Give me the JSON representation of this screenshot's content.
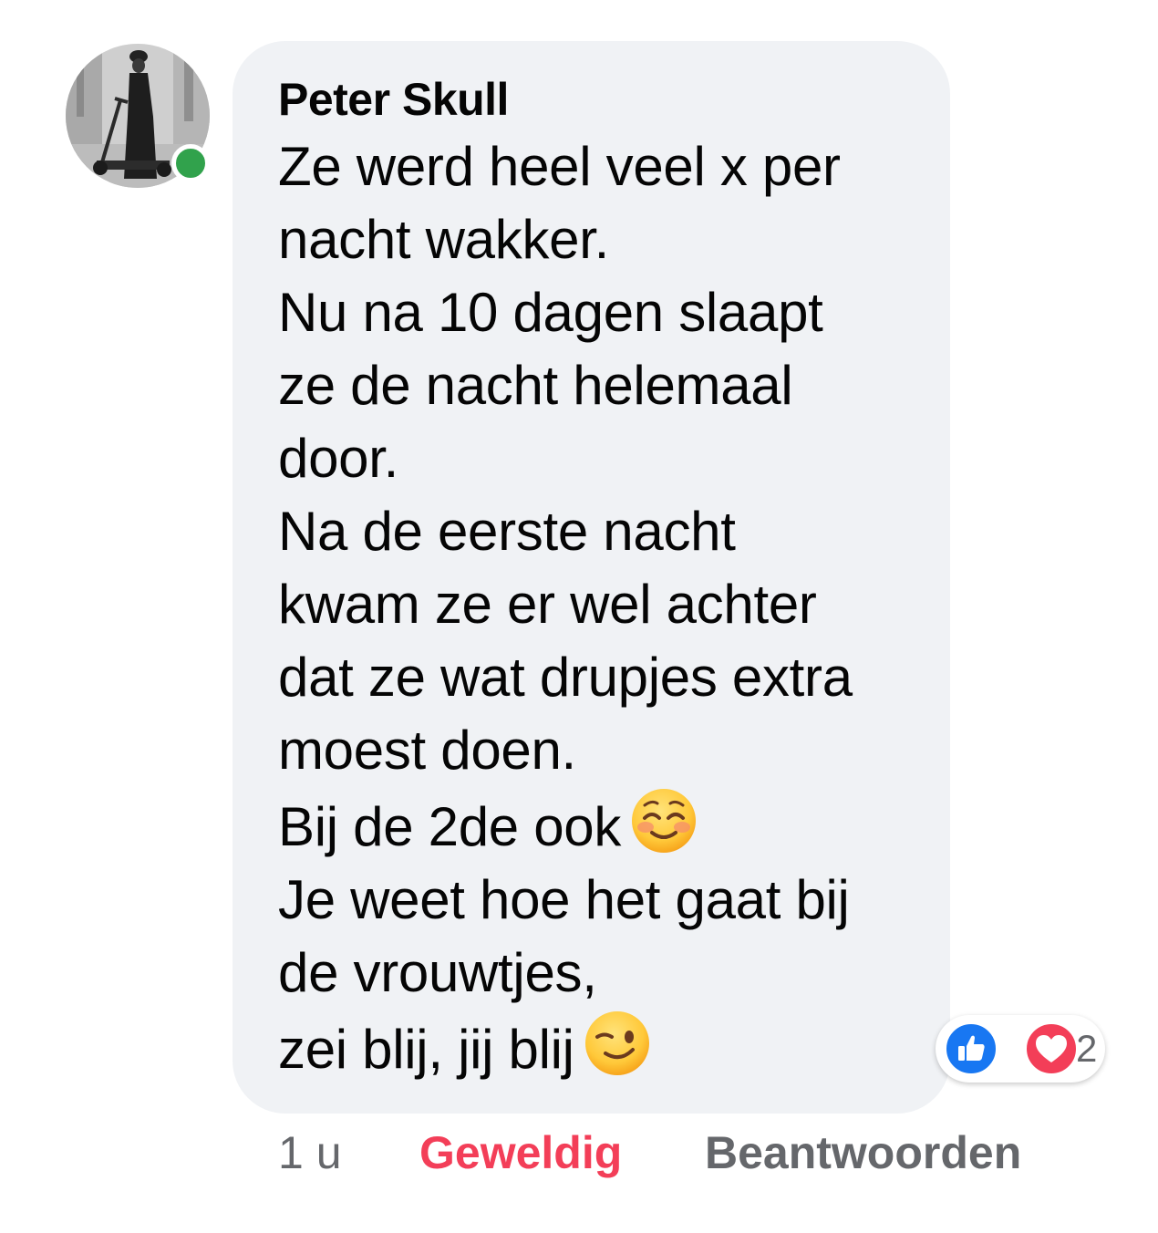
{
  "comment": {
    "author": "Peter Skull",
    "online": true,
    "lines": [
      "Ze werd heel veel x per",
      "nacht wakker.",
      "Nu na 10 dagen slaapt",
      "ze de nacht helemaal",
      "door.",
      "Na de eerste nacht",
      "kwam ze er wel achter",
      "dat ze wat drupjes extra",
      "moest doen.",
      "Bij de 2de ook",
      "Je weet hoe het gaat bij",
      "de vrouwtjes,",
      "zei blij, jij blij"
    ],
    "emojis": {
      "line_10": "smiling-face-with-smiling-eyes-emoji",
      "line_13": "winking-face-emoji"
    }
  },
  "reactions": {
    "types": [
      "like-reaction-icon",
      "love-reaction-icon"
    ],
    "count": "2"
  },
  "footer": {
    "time": "1 u",
    "reaction_label": "Geweldig",
    "reply_label": "Beantwoorden"
  },
  "colors": {
    "bubble": "#f0f2f5",
    "online": "#31a24c",
    "like": "#1877f2",
    "love": "#f33e58",
    "secondary_text": "#65676b"
  }
}
